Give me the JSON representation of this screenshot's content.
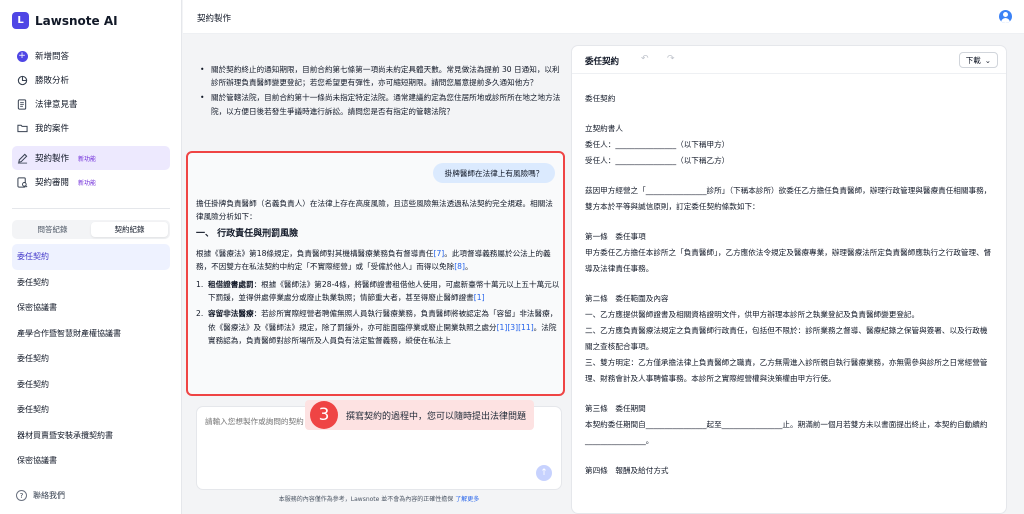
{
  "app": {
    "name": "Lawsnote AI"
  },
  "sidebar": {
    "nav": [
      {
        "label": "新增問答",
        "icon": "plus-circle-icon"
      },
      {
        "label": "勝敗分析",
        "icon": "chart-pie-icon"
      },
      {
        "label": "法律意見書",
        "icon": "document-icon"
      },
      {
        "label": "我的案件",
        "icon": "folder-icon"
      },
      {
        "label": "契約製作",
        "icon": "pen-icon",
        "badge": "新功能"
      },
      {
        "label": "契約審閱",
        "icon": "review-icon",
        "badge": "新功能"
      }
    ],
    "tabs": [
      "問答紀錄",
      "契約紀錄"
    ],
    "active_tab": "契約紀錄",
    "documents": [
      "委任契約",
      "委任契約",
      "保密協議書",
      "產學合作暨智慧財產權協議書",
      "委任契約",
      "委任契約",
      "委任契約",
      "器材買賣暨安裝承攬契約書",
      "保密協議書"
    ],
    "contact": "聯絡我們"
  },
  "header": {
    "title": "契約製作"
  },
  "chat": {
    "bullets": [
      "關於契約終止的通知期限，目前合約第七條第一項尚未約定具體天數。常見做法為提前 30 日通知，以利診所辦理負責醫師變更登記；若您希望更有彈性，亦可縮短期限。請問您屬意提前多久通知他方？",
      "關於管轄法院，目前合約第十一條尚未指定特定法院。通常建議約定為您住居所地或診所所在地之地方法院，以方便日後若發生爭議時進行訴訟。請問您是否有指定的管轄法院？"
    ],
    "user_question": "掛牌醫師在法律上有風險嗎？",
    "answer_intro": "擔任掛牌負責醫師（名義負責人）在法律上存在高度風險，且這些風險無法透過私法契約完全規避。相關法律風險分析如下：",
    "answer_heading": "一、 行政責任與刑罰風險",
    "answer_p1_a": "根據《醫療法》第18條規定，負責醫師對其機構醫療業務負有督導責任",
    "answer_p1_ref1": "[7]",
    "answer_p1_b": "。此項督導義務屬於公法上的義務，不因雙方在私法契約中約定「不實際經營」或「受僱於他人」而得以免除",
    "answer_p1_ref2": "[8]",
    "answer_p1_c": "。",
    "answer_item1_title": "租借證書處罰",
    "answer_item1_text": "：根據《醫師法》第28-4條，將醫師證書租借他人使用，可處新臺幣十萬元以上五十萬元以下罰鍰，並得併處停業處分或廢止執業執照；情節重大者，甚至得廢止醫師證書",
    "answer_item1_ref": "[1]",
    "answer_item2_title": "容留非法醫療",
    "answer_item2_text": "：若診所實際經營者聘僱無照人員執行醫療業務，負責醫師將被認定為「容留」非法醫療，依《醫療法》及《醫師法》規定，除了罰鍰外，亦可能面臨停業或廢止開業執照之處分",
    "answer_item2_ref": "[1][3][11]",
    "answer_item2_tail": "。法院實務認為，負責醫師對診所場所及人員負有法定監督義務，縱使在私法上",
    "input_placeholder": "請輸入您想製作或詢問的契約",
    "tip_number": "3",
    "tip_text": "撰寫契約的過程中，您可以隨時提出法律問題",
    "disclaimer": "本服務的內容僅作為參考，Lawsnote 並不會為內容的正確性擔保",
    "disclaimer_link": "了解更多"
  },
  "panel": {
    "title": "委任契約",
    "download_label": "下載",
    "contract_lines": [
      "委任契約",
      "",
      "立契約書人",
      "委任人：________________（以下稱甲方）",
      "受任人：________________（以下稱乙方）",
      "",
      "茲因甲方經營之「________________診所」（下稱本診所）欲委任乙方擔任負責醫師，辦理行政管理與醫療責任相關事務，雙方本於平等與誠信原則，訂定委任契約條款如下：",
      "",
      "第一條　委任事項",
      "甲方委任乙方擔任本診所之「負責醫師」，乙方應依法令規定及醫療專業，辦理醫療法所定負責醫師應執行之行政管理、督導及法律責任事務。",
      "",
      "第二條　委任範圍及內容",
      "一、乙方應提供醫師證書及相關資格證明文件，供甲方辦理本診所之執業登記及負責醫師變更登記。",
      "二、乙方應負責醫療法規定之負責醫師行政責任，包括但不限於：診所業務之督導、醫療紀錄之保管與簽署、以及行政機關之查核配合事項。",
      "三、雙方明定：乙方僅承擔法律上負責醫師之職責，乙方無需進入診所親自執行醫療業務，亦無需參與診所之日常經營管理、財務會計及人事聘僱事務。本診所之實際經營權與決策權由甲方行使。",
      "",
      "第三條　委任期間",
      "本契約委任期間自________________起至________________止。期滿前一個月若雙方未以書面提出終止，本契約自動續約________________。",
      "",
      "第四條　報酬及給付方式"
    ]
  },
  "colors": {
    "accent": "#4f46e5",
    "highlight_border": "#ef4444",
    "tip_bg": "#fde2e2"
  }
}
